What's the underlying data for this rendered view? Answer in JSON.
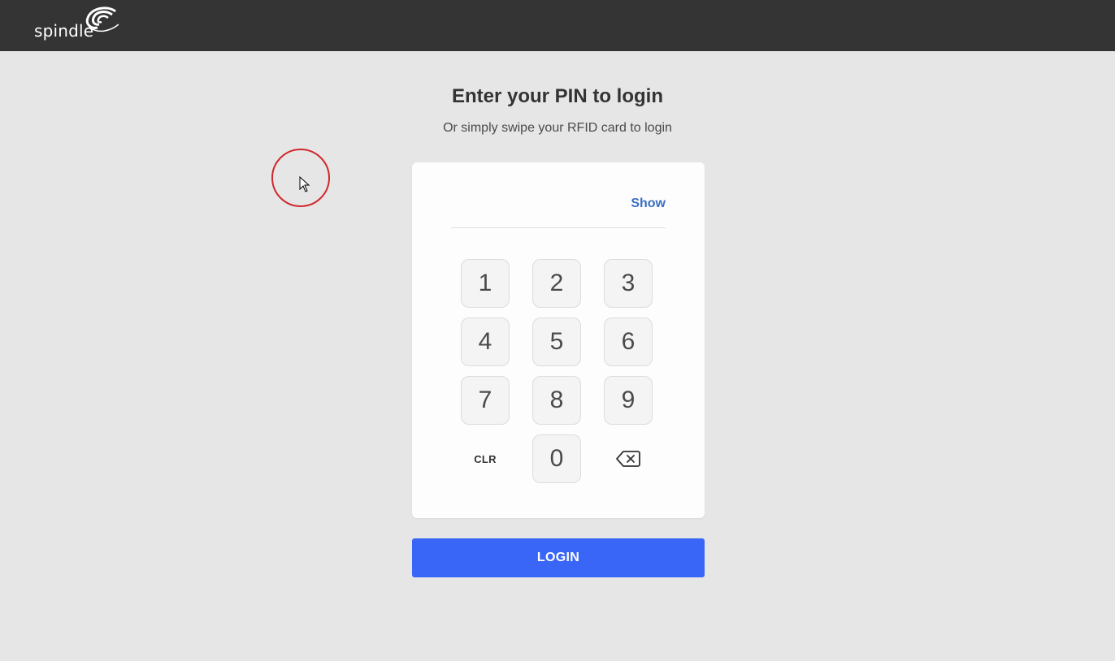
{
  "header": {
    "logo_text": "spindle",
    "logo_icon": "spindle-swirl-logo"
  },
  "main": {
    "title": "Enter your PIN to login",
    "subtitle": "Or simply swipe your RFID card to login"
  },
  "pin": {
    "value": "",
    "show_label": "Show"
  },
  "keypad": {
    "keys": [
      "1",
      "2",
      "3",
      "4",
      "5",
      "6",
      "7",
      "8",
      "9"
    ],
    "clear_label": "CLR",
    "zero_label": "0",
    "backspace_icon": "backspace-icon"
  },
  "actions": {
    "login_label": "LOGIN"
  },
  "colors": {
    "topbar": "#343434",
    "background": "#e6e6e6",
    "accent": "#3966f6",
    "link": "#3a6fc4",
    "cursor_ring": "#d0282c"
  }
}
